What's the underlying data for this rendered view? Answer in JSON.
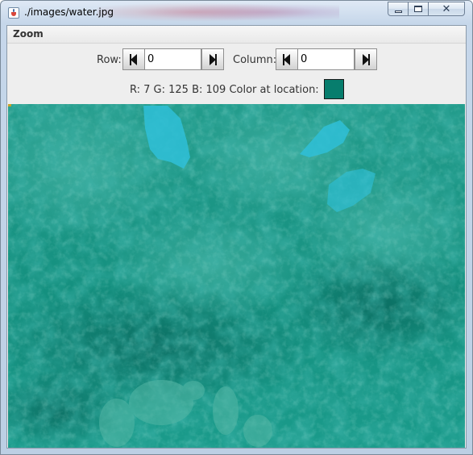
{
  "window": {
    "title": "./images/water.jpg",
    "minimize_icon": "minimize-icon",
    "maximize_icon": "maximize-icon",
    "close_icon": "close-icon",
    "close_glyph": "✕"
  },
  "menubar": {
    "items": [
      {
        "label": "Zoom"
      }
    ]
  },
  "controls": {
    "row": {
      "label": "Row:",
      "value": "0"
    },
    "column": {
      "label": "Column:",
      "value": "0"
    },
    "prev_icon": "arrow-left-icon",
    "next_icon": "arrow-right-icon"
  },
  "pixel_info": {
    "text": "R: 7 G: 125 B: 109 Color at location:",
    "swatch_color": "#077d6d"
  },
  "image": {
    "description_colors": {
      "base": "#1a9a8a",
      "dark": "#0c6e62",
      "light": "#3db3a4",
      "highlight": "#2bb6d0"
    }
  }
}
